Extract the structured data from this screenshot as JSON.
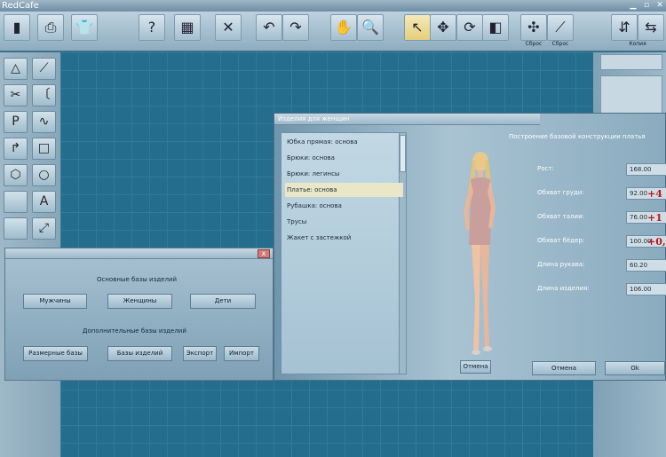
{
  "app": {
    "title": "RedCafe"
  },
  "toolbar": {
    "buttons": [
      {
        "name": "new",
        "glyph": "▮",
        "selected": false
      },
      {
        "name": "print",
        "glyph": "⎙",
        "selected": false
      },
      {
        "name": "shirt",
        "glyph": "👕",
        "selected": false
      },
      {
        "name": "help",
        "glyph": "?",
        "selected": false
      },
      {
        "name": "calculator",
        "glyph": "▦",
        "selected": false
      },
      {
        "name": "delete",
        "glyph": "✕",
        "selected": false
      },
      {
        "name": "undo",
        "glyph": "↶",
        "selected": false
      },
      {
        "name": "redo",
        "glyph": "↷",
        "selected": false
      },
      {
        "name": "hand",
        "glyph": "✋",
        "selected": false
      },
      {
        "name": "zoom",
        "glyph": "🔍",
        "selected": false
      },
      {
        "name": "pointer",
        "glyph": "↖",
        "selected": true
      },
      {
        "name": "move",
        "glyph": "✥",
        "selected": false
      },
      {
        "name": "rotate",
        "glyph": "⟳",
        "selected": false
      },
      {
        "name": "mirror",
        "glyph": "◧",
        "selected": false
      },
      {
        "name": "reset-1",
        "glyph": "✣",
        "selected": false
      },
      {
        "name": "reset-2",
        "glyph": "⟋",
        "selected": false
      },
      {
        "name": "flip-vertical",
        "glyph": "⇵",
        "selected": false
      },
      {
        "name": "flip-horizontal",
        "glyph": "⇆",
        "selected": false
      }
    ],
    "reset1_label": "Сброс",
    "reset2_label": "Сброс",
    "copy_label": "Копия"
  },
  "left_tools": [
    "△",
    "⟋",
    "✂",
    "〔",
    "P",
    "∿",
    "↱",
    "□",
    "⬡",
    "○",
    "",
    "A",
    "",
    "⤢"
  ],
  "bases_dialog": {
    "close_label": "x",
    "main_title": "Основные базы изделий",
    "main_buttons": [
      "Мужчины",
      "Женщины",
      "Дети"
    ],
    "extra_title": "Дополнительные базы изделий",
    "extra_buttons": [
      "Размерные базы",
      "Базы изделий",
      "Экспорт",
      "Импорт"
    ]
  },
  "women_dialog": {
    "title": "Изделия для женщин",
    "items": [
      "Юбка прямая: основа",
      "Брюки: основа",
      "Брюки: легинсы",
      "Платье: основа",
      "Рубашка: основа",
      "Трусы",
      "Жакет с застежкой"
    ],
    "selected_index": 3,
    "build_title": "Построение базовой конструкции платья",
    "params": [
      {
        "label": "Рост:",
        "value": "168.00",
        "delta": ""
      },
      {
        "label": "Обхват груди:",
        "value": "92.00",
        "delta": "+4"
      },
      {
        "label": "Обхват талии:",
        "value": "76.00",
        "delta": "+1"
      },
      {
        "label": "Обхват бёдер:",
        "value": "100.00",
        "delta": "+0,"
      },
      {
        "label": "Длина рукава:",
        "value": "60.20",
        "delta": ""
      },
      {
        "label": "Длина изделия:",
        "value": "106.00",
        "delta": ""
      }
    ],
    "cancel_small": "Отмена",
    "cancel": "Отмена",
    "ok": "Ok"
  }
}
